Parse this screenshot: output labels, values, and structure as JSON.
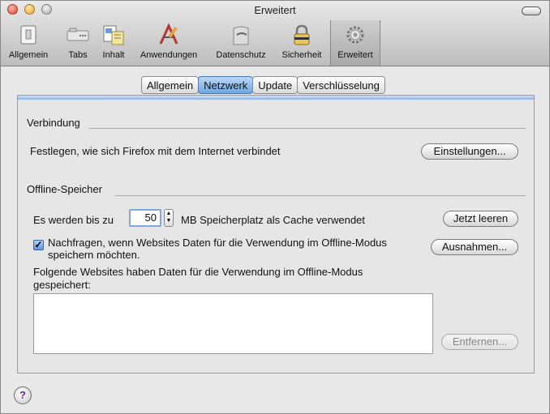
{
  "window": {
    "title": "Erweitert"
  },
  "toolbar": {
    "items": [
      {
        "label": "Allgemein",
        "icon": "switch-icon"
      },
      {
        "label": "Tabs",
        "icon": "tabs-icon"
      },
      {
        "label": "Inhalt",
        "icon": "content-icon"
      },
      {
        "label": "Anwendungen",
        "icon": "applications-icon"
      },
      {
        "label": "Datenschutz",
        "icon": "mask-icon"
      },
      {
        "label": "Sicherheit",
        "icon": "lock-icon"
      },
      {
        "label": "Erweitert",
        "icon": "gear-icon"
      }
    ],
    "active": "Erweitert"
  },
  "tabs": [
    "Allgemein",
    "Netzwerk",
    "Update",
    "Verschlüsselung"
  ],
  "active_tab": "Netzwerk",
  "connection": {
    "heading": "Verbindung",
    "description": "Festlegen, wie sich Firefox mit dem Internet verbindet",
    "settings_button": "Einstellungen..."
  },
  "offline": {
    "heading": "Offline-Speicher",
    "cache_prefix": "Es werden bis zu",
    "cache_value": "50",
    "cache_suffix": "MB Speicherplatz als Cache verwendet",
    "clear_button": "Jetzt leeren",
    "ask_checked": true,
    "ask_line1": "Nachfragen, wenn Websites Daten für die Verwendung im Offline-Modus",
    "ask_line2": "speichern möchten.",
    "exceptions_button": "Ausnahmen...",
    "sites_line1": "Folgende Websites haben Daten für die Verwendung im Offline-Modus",
    "sites_line2": "gespeichert:",
    "remove_button": "Entfernen..."
  },
  "help": {
    "label": "?"
  },
  "colors": {
    "accent": "#6ea7e3",
    "help": "#5a2f95"
  }
}
